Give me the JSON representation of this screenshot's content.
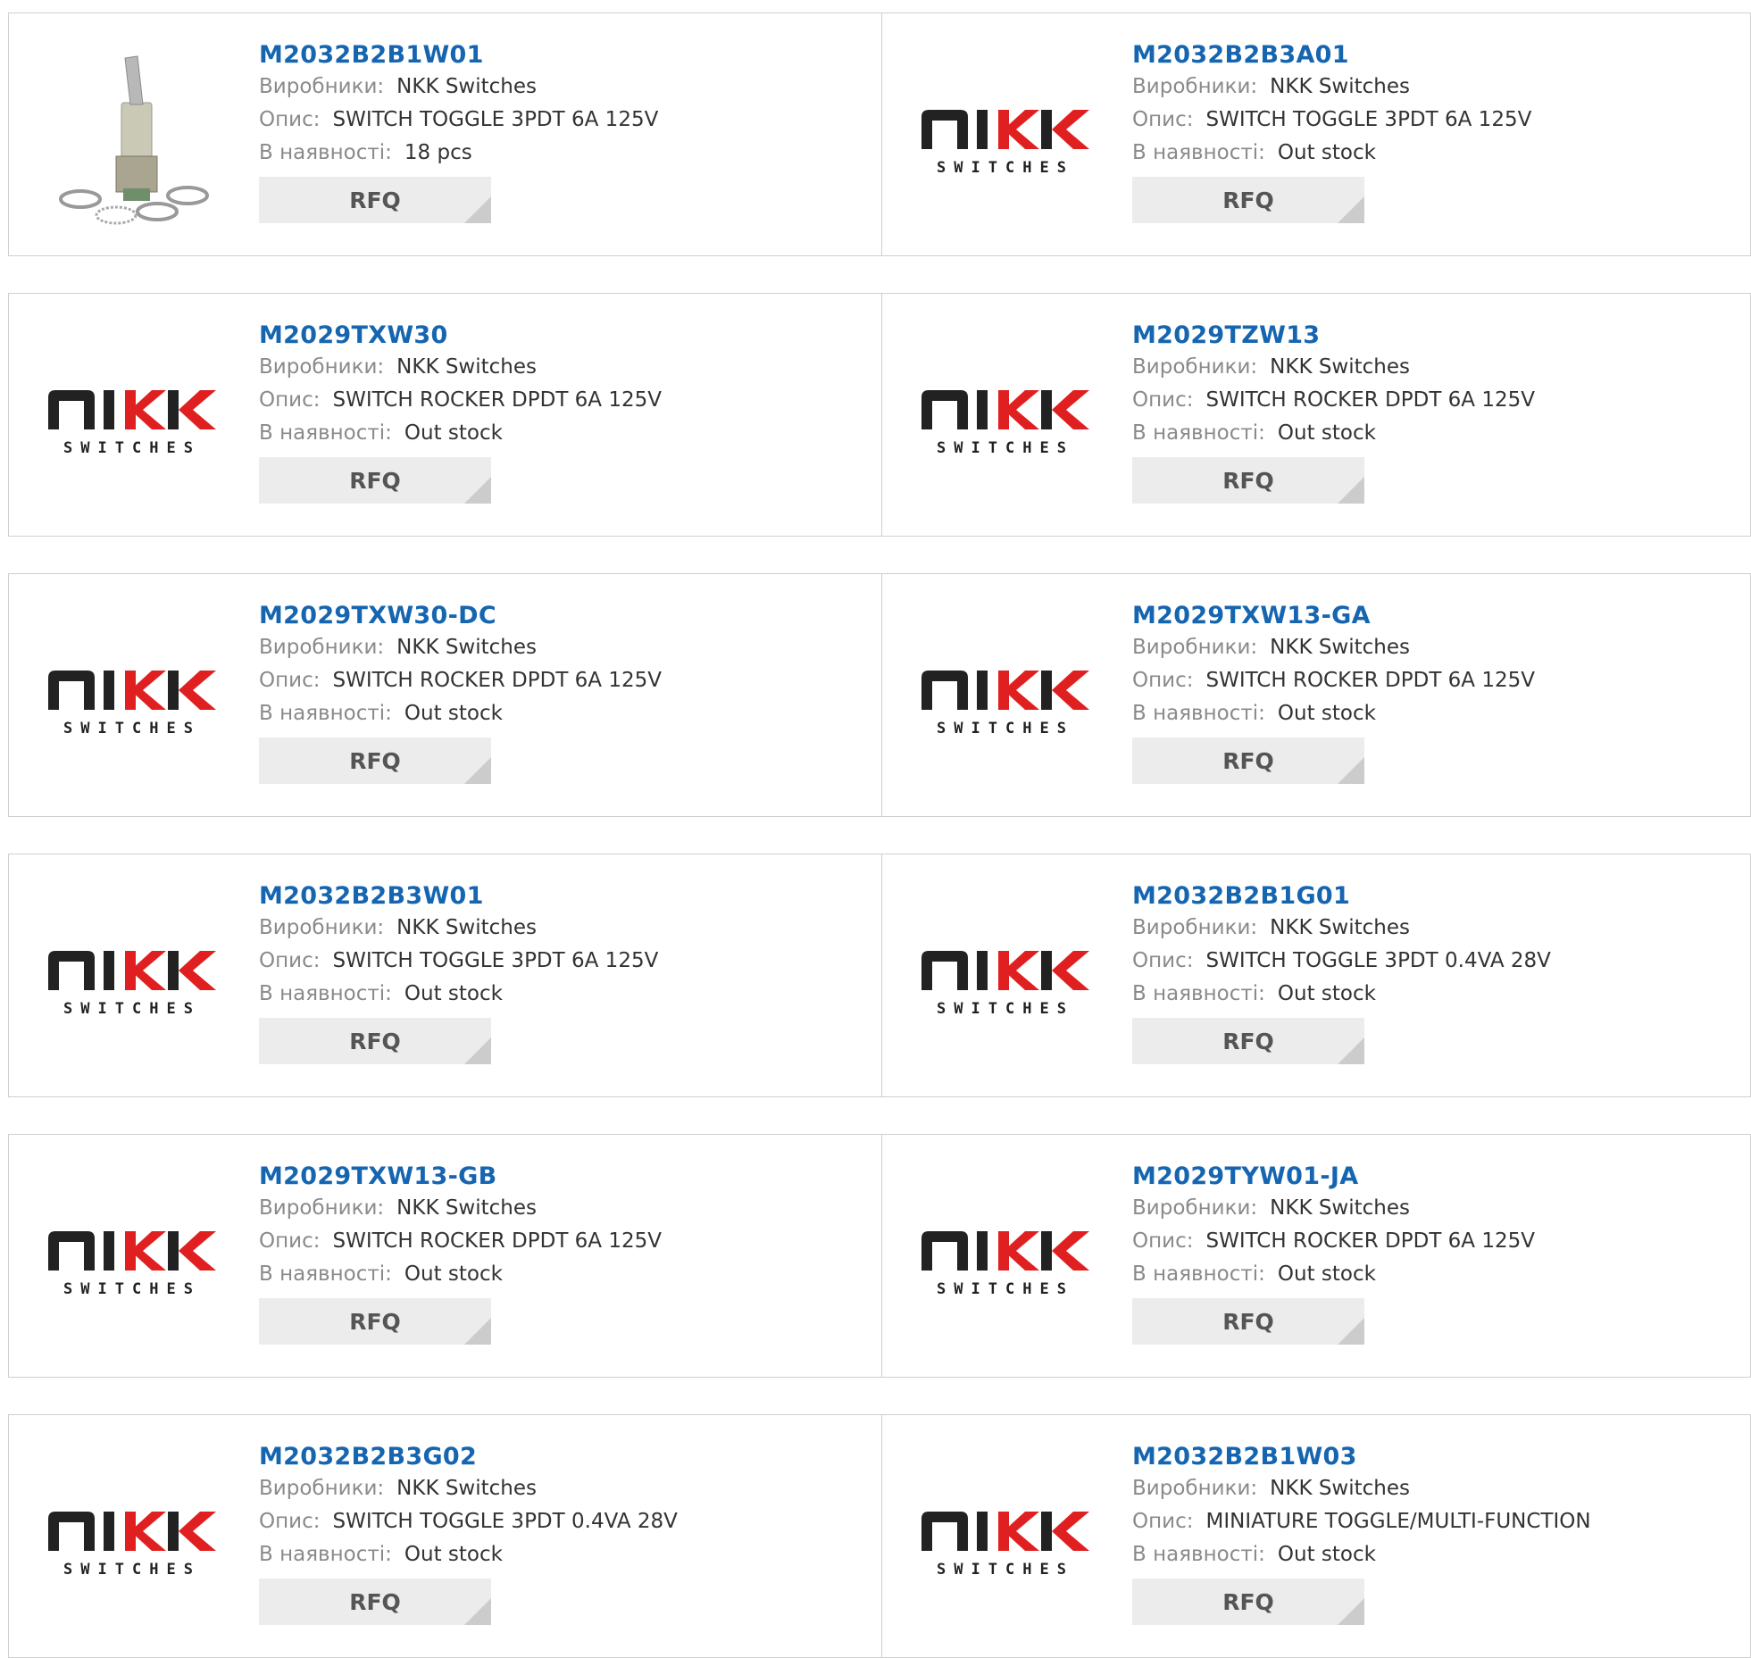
{
  "labels": {
    "manufacturer": "Виробники:",
    "description": "Опис:",
    "stock": "В наявності:",
    "rfq": "RFQ"
  },
  "logo": {
    "brand": "NKK",
    "tagline": "SWITCHES",
    "red": "#e02020",
    "dark": "#222222"
  },
  "colors": {
    "part_link": "#1565b0",
    "border": "#cfcfcf",
    "button_bg": "#ececec"
  },
  "products": [
    {
      "part": "M2032B2B1W01",
      "manufacturer": "NKK Switches",
      "description": "SWITCH TOGGLE 3PDT 6A 125V",
      "stock": "18 pcs",
      "image": "toggle-switch-photo"
    },
    {
      "part": "M2032B2B3A01",
      "manufacturer": "NKK Switches",
      "description": "SWITCH TOGGLE 3PDT 6A 125V",
      "stock": "Out stock",
      "image": "nkk-logo"
    },
    {
      "part": "M2029TXW30",
      "manufacturer": "NKK Switches",
      "description": "SWITCH ROCKER DPDT 6A 125V",
      "stock": "Out stock",
      "image": "nkk-logo"
    },
    {
      "part": "M2029TZW13",
      "manufacturer": "NKK Switches",
      "description": "SWITCH ROCKER DPDT 6A 125V",
      "stock": "Out stock",
      "image": "nkk-logo"
    },
    {
      "part": "M2029TXW30-DC",
      "manufacturer": "NKK Switches",
      "description": "SWITCH ROCKER DPDT 6A 125V",
      "stock": "Out stock",
      "image": "nkk-logo"
    },
    {
      "part": "M2029TXW13-GA",
      "manufacturer": "NKK Switches",
      "description": "SWITCH ROCKER DPDT 6A 125V",
      "stock": "Out stock",
      "image": "nkk-logo"
    },
    {
      "part": "M2032B2B3W01",
      "manufacturer": "NKK Switches",
      "description": "SWITCH TOGGLE 3PDT 6A 125V",
      "stock": "Out stock",
      "image": "nkk-logo"
    },
    {
      "part": "M2032B2B1G01",
      "manufacturer": "NKK Switches",
      "description": "SWITCH TOGGLE 3PDT 0.4VA 28V",
      "stock": "Out stock",
      "image": "nkk-logo"
    },
    {
      "part": "M2029TXW13-GB",
      "manufacturer": "NKK Switches",
      "description": "SWITCH ROCKER DPDT 6A 125V",
      "stock": "Out stock",
      "image": "nkk-logo"
    },
    {
      "part": "M2029TYW01-JA",
      "manufacturer": "NKK Switches",
      "description": "SWITCH ROCKER DPDT 6A 125V",
      "stock": "Out stock",
      "image": "nkk-logo"
    },
    {
      "part": "M2032B2B3G02",
      "manufacturer": "NKK Switches",
      "description": "SWITCH TOGGLE 3PDT 0.4VA 28V",
      "stock": "Out stock",
      "image": "nkk-logo"
    },
    {
      "part": "M2032B2B1W03",
      "manufacturer": "NKK Switches",
      "description": "MINIATURE TOGGLE/MULTI-FUNCTION",
      "stock": "Out stock",
      "image": "nkk-logo"
    }
  ]
}
